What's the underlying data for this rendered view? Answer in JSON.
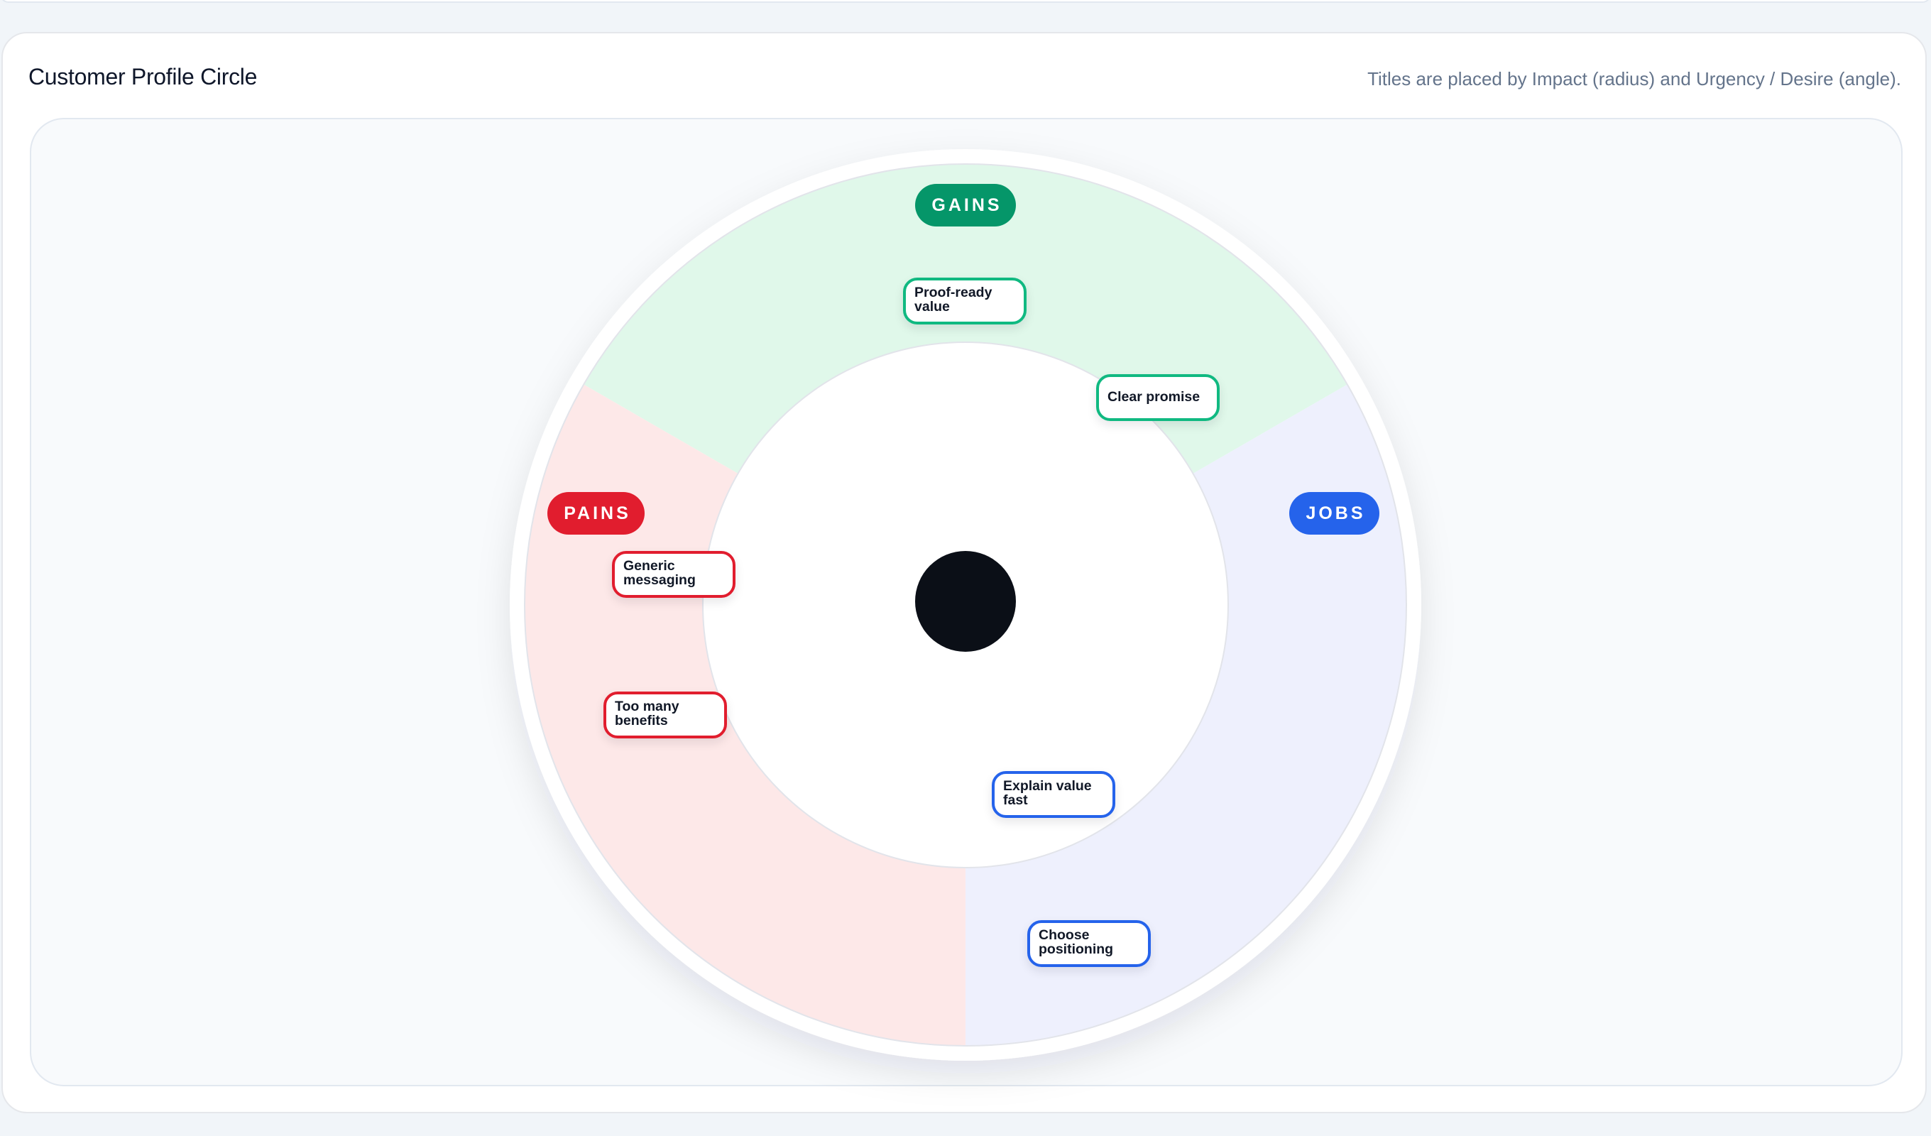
{
  "card": {
    "title": "Customer Profile Circle",
    "hint": "Titles are placed by Impact (radius) and Urgency / Desire (angle)."
  },
  "segments": {
    "gains": {
      "label": "GAINS",
      "fill": "#e0f8ea",
      "accent": "#059669"
    },
    "pains": {
      "label": "PAINS",
      "fill": "#fde8e8",
      "accent": "#e11d2e"
    },
    "jobs": {
      "label": "JOBS",
      "fill": "#eef0fd",
      "accent": "#2563eb"
    }
  },
  "items": {
    "gains": [
      {
        "line1": "Proof-ready",
        "line2": "value"
      },
      {
        "line1": "Clear promise",
        "line2": ""
      }
    ],
    "pains": [
      {
        "line1": "Generic",
        "line2": "messaging"
      },
      {
        "line1": "Too many",
        "line2": "benefits"
      }
    ],
    "jobs": [
      {
        "line1": "Explain value",
        "line2": "fast"
      },
      {
        "line1": "Choose",
        "line2": "positioning"
      }
    ]
  },
  "center": {
    "icon": "person-icon",
    "glyph": ""
  }
}
